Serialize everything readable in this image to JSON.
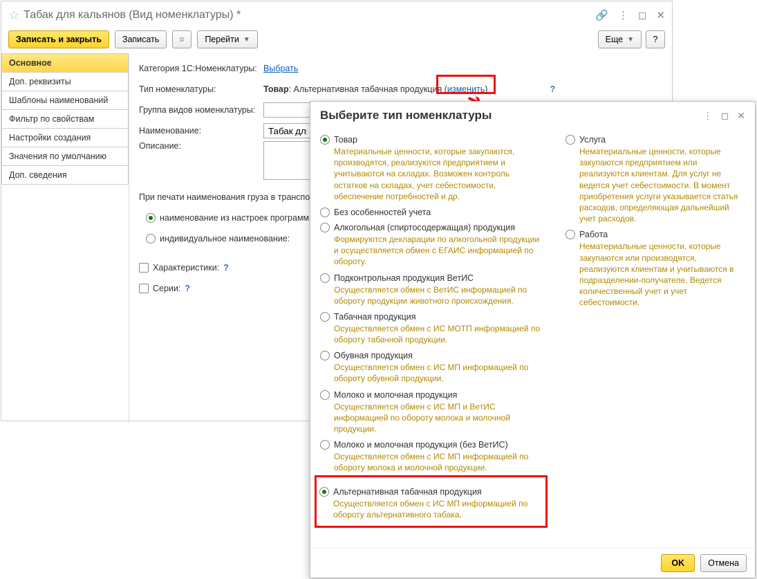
{
  "mainWindow": {
    "title": "Табак для кальянов (Вид номенклатуры) *",
    "toolbar": {
      "saveClose": "Записать и закрыть",
      "save": "Записать",
      "goto": "Перейти",
      "more": "Еще",
      "help": "?"
    },
    "sidebar": [
      "Основное",
      "Доп. реквизиты",
      "Шаблоны наименований",
      "Фильтр по свойствам",
      "Настройки создания",
      "Значения по умолчанию",
      "Доп. сведения"
    ],
    "activeSidebar": 0,
    "form": {
      "catLabel": "Категория 1С:Номенклатуры:",
      "catLink": "Выбрать",
      "typeLabel": "Тип номенклатуры:",
      "typeValueBold": "Товар",
      "typeValueRest": ": Альтернативная табачная продукция (",
      "typeChange": "изменить",
      "typeClose": ")",
      "typeHint": "?",
      "groupLabel": "Группа видов номенклатуры:",
      "nameLabel": "Наименование:",
      "nameValue": "Табак для к",
      "descLabel": "Описание:",
      "printLabel": "При печати наименования груза в транспо",
      "radio1": "наименование из настроек программы",
      "radio2": "индивидуальное наименование:",
      "chkChar": "Характеристики:",
      "chkSeries": "Серии:"
    }
  },
  "popup": {
    "title": "Выберите тип номенклатуры",
    "left": {
      "tovar": {
        "label": "Товар",
        "desc": "Материальные ценности, которые закупаются, производятся, реализуются предприятием и учитываются на складах. Возможен контроль остатков на складах, учет себестоимости, обеспечение потребностей и др."
      },
      "o1": {
        "label": "Без особенностей учета"
      },
      "o2": {
        "label": "Алкогольная (спиртосодержащая) продукция",
        "desc": "Формируются декларации по алкогольной продукции и осуществляется обмен с ЕГАИС информацией по обороту."
      },
      "o3": {
        "label": "Подконтрольная продукция ВетИС",
        "desc": "Осуществляется обмен с ВетИС информацией по обороту продукции животного происхождения."
      },
      "o4": {
        "label": "Табачная продукция",
        "desc": "Осуществляется обмен с ИС МОТП информацией по обороту табачной продукции."
      },
      "o5": {
        "label": "Обувная продукция",
        "desc": "Осуществляется обмен с ИС МП информацией по обороту обувной продукции."
      },
      "o6": {
        "label": "Молоко и молочная продукция",
        "desc": "Осуществляется обмен с ИС МП и ВетИС информацией по обороту молока и молочной продукции."
      },
      "o7": {
        "label": "Молоко и молочная продукция (без ВетИС)",
        "desc": "Осуществляется обмен с ИС МП информацией по обороту молока и молочной продукции."
      },
      "o8": {
        "label": "Альтернативная табачная продукция",
        "desc": "Осуществляется обмен с ИС МП информацией по обороту альтернативного табака."
      }
    },
    "right": {
      "usluga": {
        "label": "Услуга",
        "desc": "Нематериальные ценности, которые закупаются предприятием или реализуются клиентам. Для услуг не ведется учет себестоимости. В момент приобретения услуги указывается статья расходов, определяющая дальнейший учет расходов."
      },
      "rabota": {
        "label": "Работа",
        "desc": "Нематериальные ценности, которые закупаются или производятся, реализуются клиентам и учитываются в подразделении-получателе. Ведется количественный учет и учет себестоимости."
      }
    },
    "buttons": {
      "ok": "OK",
      "cancel": "Отмена"
    }
  }
}
